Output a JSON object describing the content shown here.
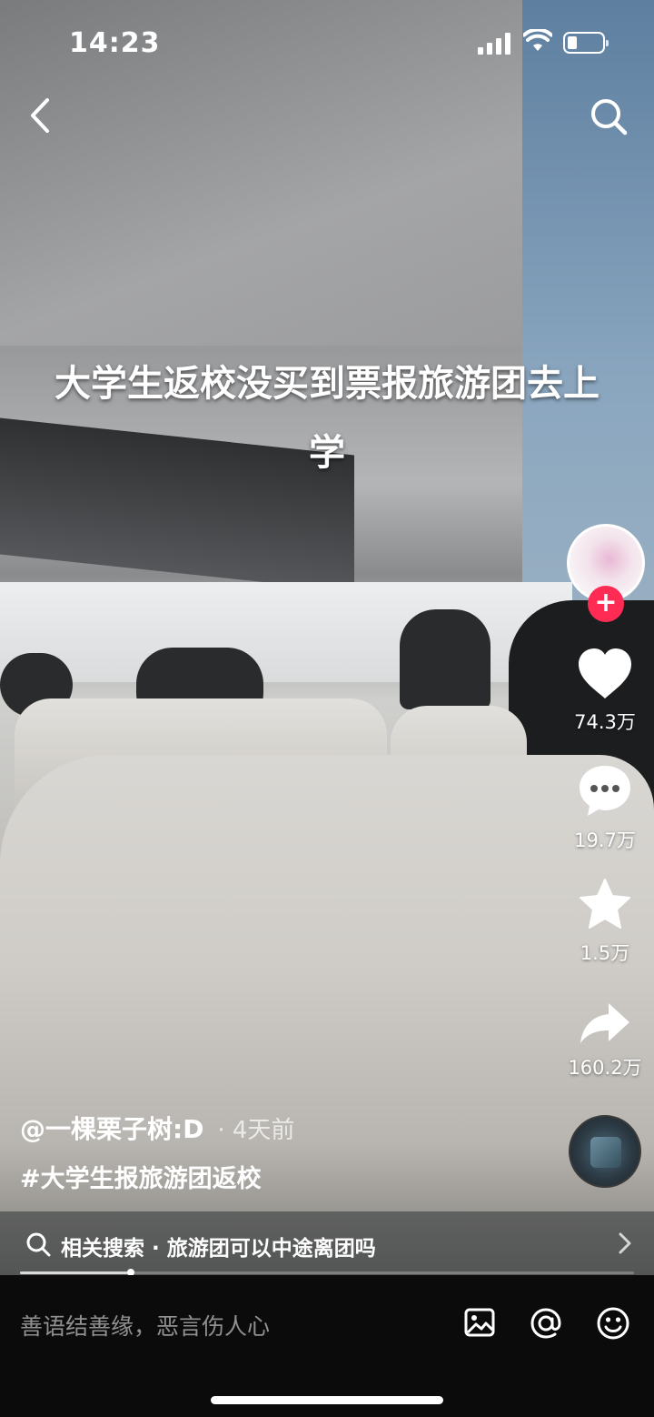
{
  "status_bar": {
    "time": "14:23"
  },
  "video": {
    "overlay_title": "大学生返校没买到票报旅游团去上学"
  },
  "actions": {
    "like_count": "74.3万",
    "comment_count": "19.7万",
    "favorite_count": "1.5万",
    "share_count": "160.2万"
  },
  "caption": {
    "author": "@一棵栗子树:D",
    "time_ago": "· 4天前",
    "hashtag": "#大学生报旅游团返校"
  },
  "related_search": {
    "text": "相关搜索 · 旅游团可以中途离团吗"
  },
  "playback": {
    "progress_fraction": 0.18
  },
  "comment_bar": {
    "placeholder": "善语结善缘，恶言伤人心"
  },
  "colors": {
    "follow_accent": "#fe2c55"
  },
  "icons": [
    "back-icon",
    "search-icon",
    "plus-icon",
    "heart-icon",
    "comment-icon",
    "star-icon",
    "share-icon",
    "image-icon",
    "at-icon",
    "emoji-icon"
  ]
}
